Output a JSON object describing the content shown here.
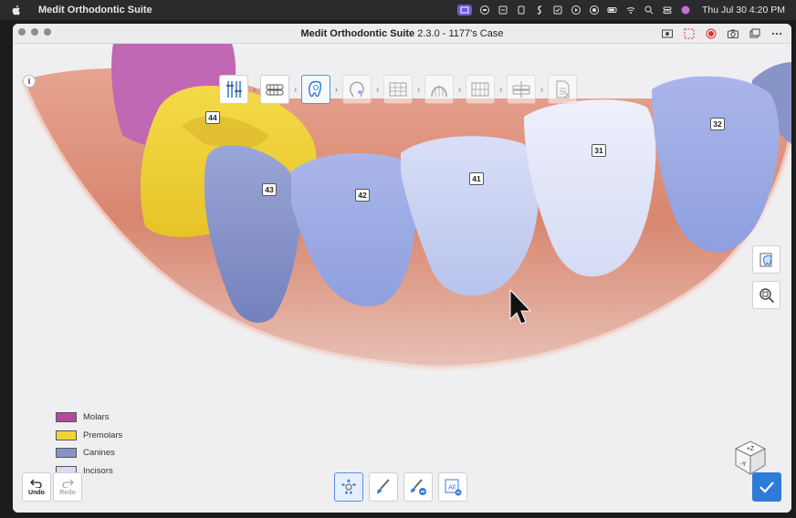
{
  "menubar": {
    "app_name": "Medit Orthodontic Suite",
    "clock": "Thu Jul 30  4:20 PM"
  },
  "window": {
    "title_bold": "Medit Orthodontic Suite",
    "title_rest": " 2.3.0 - 1177's Case"
  },
  "steps": [
    {
      "name": "tooth-segmentation-step",
      "state": "done"
    },
    {
      "name": "arch-alignment-step",
      "state": "done"
    },
    {
      "name": "tooth-selection-step",
      "state": "active"
    },
    {
      "name": "face-profile-step",
      "state": "disabled"
    },
    {
      "name": "analysis-step",
      "state": "disabled"
    },
    {
      "name": "arch-form-step",
      "state": "disabled"
    },
    {
      "name": "ipr-step",
      "state": "disabled"
    },
    {
      "name": "attachment-step",
      "state": "disabled"
    },
    {
      "name": "export-step",
      "state": "disabled"
    }
  ],
  "teeth": {
    "t44": "44",
    "t43": "43",
    "t42": "42",
    "t41": "41",
    "t31": "31",
    "t32": "32"
  },
  "legend": [
    {
      "label": "Molars",
      "color": "#b14a9c"
    },
    {
      "label": "Premolars",
      "color": "#f2d33a"
    },
    {
      "label": "Canines",
      "color": "#8794c8"
    },
    {
      "label": "Incisors",
      "color": "#d6dcf5"
    }
  ],
  "undo": {
    "label": "Undo"
  },
  "redo": {
    "label": "Redo"
  },
  "bottom_tools": {
    "all_label": "All"
  },
  "cube": {
    "z_label": "+Z",
    "y_label": "-Y"
  },
  "colors": {
    "accent": "#2f7bd8",
    "molar": "#b14a9c",
    "premolar": "#f2d33a",
    "canine": "#8794c8",
    "incisor": "#d6dcf5",
    "gum": "#d98c7a"
  }
}
